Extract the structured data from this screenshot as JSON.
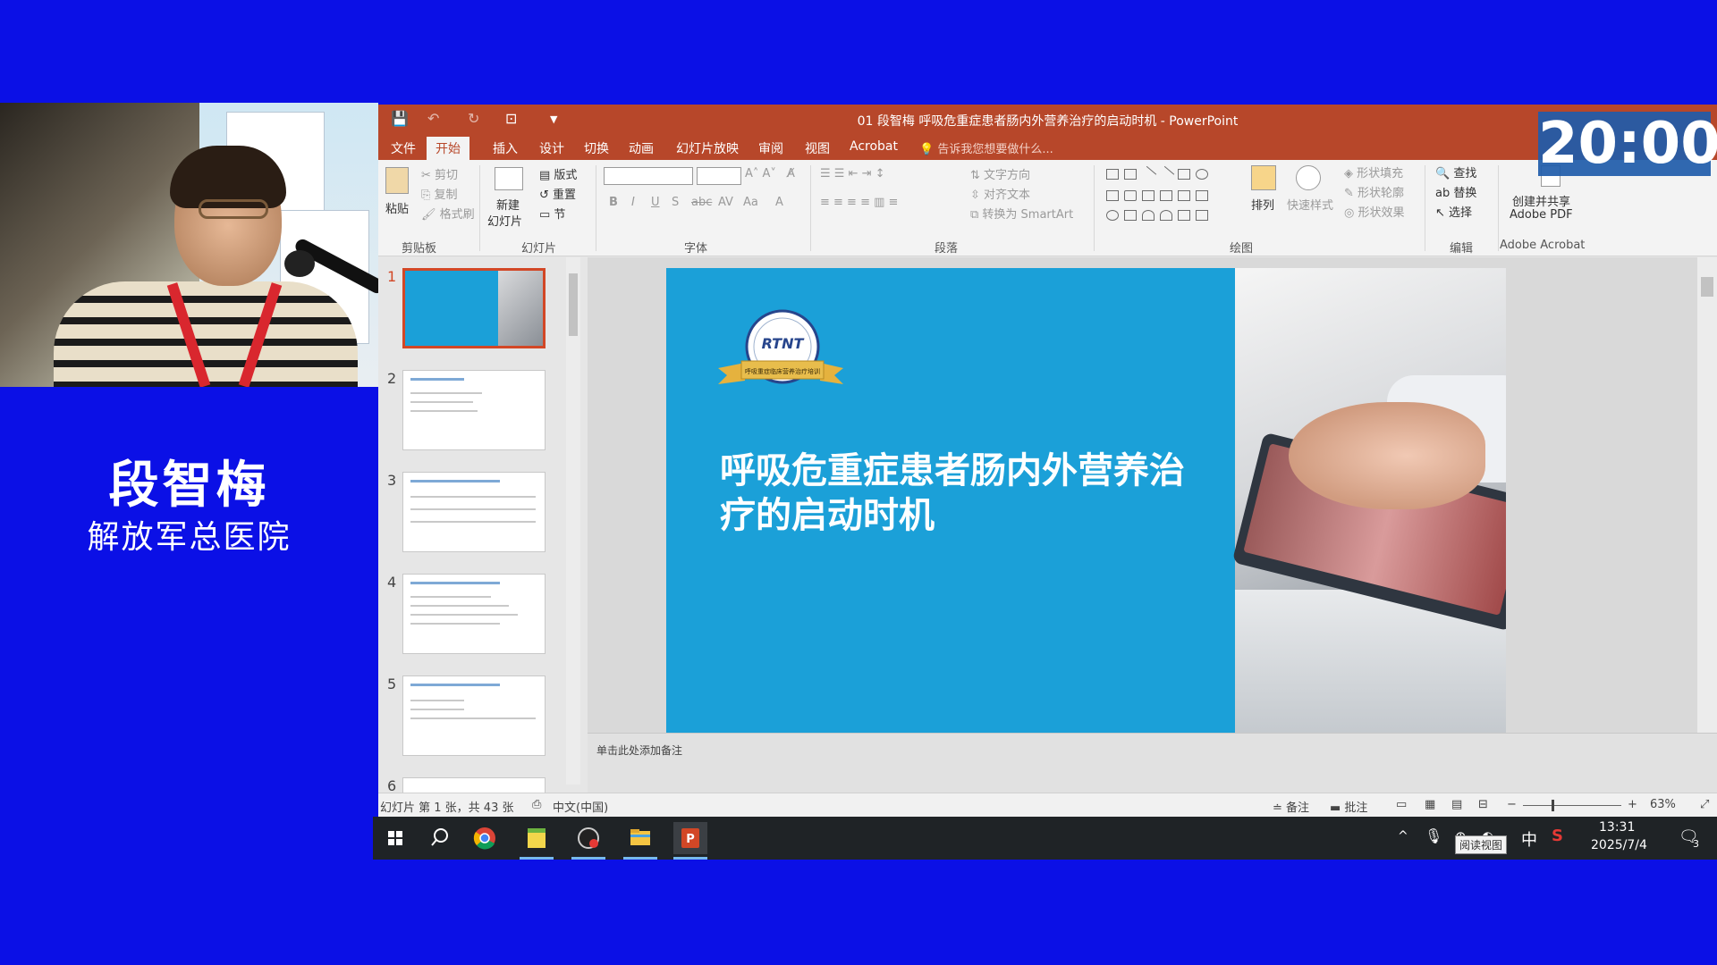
{
  "speaker": {
    "name": "段智梅",
    "organization": "解放军总医院"
  },
  "timer": {
    "value": "20:00"
  },
  "window": {
    "title": "01 段智梅 呼吸危重症患者肠内外营养治疗的启动时机 - PowerPoint"
  },
  "ribbon": {
    "tabs": [
      "文件",
      "开始",
      "插入",
      "设计",
      "切换",
      "动画",
      "幻灯片放映",
      "审阅",
      "视图",
      "Acrobat"
    ],
    "active_tab": "开始",
    "tell_me": "告诉我您想要做什么...",
    "clipboard": {
      "paste": "粘贴",
      "cut": "剪切",
      "copy": "复制",
      "format_painter": "格式刷",
      "group": "剪贴板"
    },
    "slides": {
      "new_slide_1": "新建",
      "new_slide_2": "幻灯片",
      "layout": "版式",
      "reset": "重置",
      "section": "节",
      "group": "幻灯片"
    },
    "font": {
      "group": "字体"
    },
    "paragraph": {
      "text_direction": "文字方向",
      "align_text": "对齐文本",
      "smartart": "转换为 SmartArt",
      "group": "段落"
    },
    "drawing": {
      "arrange": "排列",
      "quick_styles": "快速样式",
      "shape_fill": "形状填充",
      "shape_outline": "形状轮廓",
      "shape_effects": "形状效果",
      "group": "绘图"
    },
    "editing": {
      "find": "查找",
      "replace": "替换",
      "select": "选择",
      "group": "编辑"
    },
    "acrobat": {
      "create_1": "创建并共享",
      "create_2": "Adobe PDF",
      "group": "Adobe Acrobat"
    }
  },
  "thumbnails": {
    "numbers": [
      "1",
      "2",
      "3",
      "4",
      "5",
      "6"
    ],
    "selected": 1
  },
  "slide": {
    "title_line1": "呼吸危重症患者肠内外营养治",
    "title_line2": "疗的启动时机",
    "logo_text": "RTNT",
    "logo_banner": "呼吸重症临床营养治疗培训"
  },
  "notes": {
    "placeholder": "单击此处添加备注"
  },
  "status": {
    "slide_info": "幻灯片 第 1 张，共 43 张",
    "language": "中文(中国)",
    "notes": "备注",
    "comments": "批注",
    "zoom": "63%",
    "zoom_level": 0.63
  },
  "taskbar": {
    "time": "13:31",
    "date": "2025/7/4",
    "ime": "中",
    "tooltip": "阅读视图",
    "notif_count": "3"
  },
  "colors": {
    "accent": "#b7472a",
    "slide_blue": "#1ba0d8",
    "background": "#0b10e6"
  }
}
